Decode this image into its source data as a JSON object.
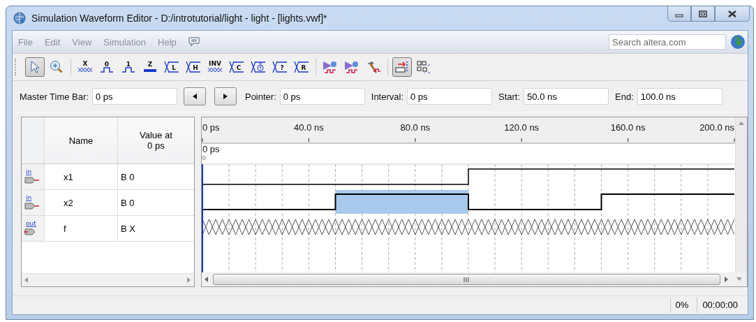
{
  "window": {
    "title": "Simulation Waveform Editor - D:/introtutorial/light - light - [lights.vwf]*"
  },
  "menu": [
    "File",
    "Edit",
    "View",
    "Simulation",
    "Help"
  ],
  "search": {
    "placeholder": "Search altera.com"
  },
  "toolbar": [
    {
      "kind": "pointer",
      "selected": true,
      "separator_before": false
    },
    {
      "kind": "zoom",
      "selected": false,
      "separator_before": false
    },
    {
      "kind": "unknown",
      "label": "X",
      "selected": false,
      "separator_before": true
    },
    {
      "kind": "level",
      "label": "0",
      "selected": false,
      "separator_before": false
    },
    {
      "kind": "level",
      "label": "1",
      "selected": false,
      "separator_before": false
    },
    {
      "kind": "bar",
      "label": "Z",
      "selected": false,
      "separator_before": false
    },
    {
      "kind": "cross",
      "label": "L",
      "selected": false,
      "separator_before": false
    },
    {
      "kind": "cross",
      "label": "H",
      "selected": false,
      "separator_before": false
    },
    {
      "kind": "unknown",
      "label": "INV",
      "selected": false,
      "separator_before": false
    },
    {
      "kind": "cross",
      "label": "C",
      "selected": false,
      "separator_before": false
    },
    {
      "kind": "clock",
      "selected": false,
      "separator_before": false
    },
    {
      "kind": "cross",
      "label": "?",
      "selected": false,
      "separator_before": false
    },
    {
      "kind": "cross",
      "label": "R",
      "selected": false,
      "separator_before": false
    },
    {
      "kind": "run",
      "selected": false,
      "separator_before": true
    },
    {
      "kind": "run",
      "selected": false,
      "separator_before": false
    },
    {
      "kind": "hammer",
      "selected": false,
      "separator_before": false
    },
    {
      "kind": "snap",
      "selected": true,
      "separator_before": true
    },
    {
      "kind": "grid",
      "selected": false,
      "separator_before": false
    }
  ],
  "time_controls": [
    {
      "kind": "field",
      "label": "Master Time Bar:",
      "value": "0 ps"
    },
    {
      "kind": "prev"
    },
    {
      "kind": "next"
    },
    {
      "kind": "field",
      "label": "Pointer:",
      "value": "0 ps"
    },
    {
      "kind": "field",
      "label": "Interval:",
      "value": "0 ps"
    },
    {
      "kind": "field",
      "label": "Start:",
      "value": "50.0 ns"
    },
    {
      "kind": "field",
      "label": "End:",
      "value": "100.0 ns"
    }
  ],
  "columns": [
    {
      "lines": [
        "Name"
      ]
    },
    {
      "lines": [
        "Value at",
        "0 ps"
      ]
    }
  ],
  "signals": [
    {
      "port": "in",
      "name": "x1",
      "value": "B 0",
      "kind": "bit",
      "segments": [
        {
          "kind": "low"
        },
        {
          "kind": "low"
        },
        {
          "kind": "high"
        },
        {
          "kind": "high"
        }
      ]
    },
    {
      "port": "in",
      "name": "x2",
      "value": "B 0",
      "kind": "bit",
      "segments": [
        {
          "kind": "low"
        },
        {
          "kind": "highlighted"
        },
        {
          "kind": "low"
        },
        {
          "kind": "high"
        }
      ]
    },
    {
      "port": "out",
      "name": "f",
      "value": "B X",
      "kind": "unknown"
    }
  ],
  "waveform": {
    "marker_label": "0 ps",
    "ruler": [
      "0 ps",
      "40.0 ns",
      "80.0 ns",
      "120.0 ns",
      "160.0 ns",
      "200.0 ns"
    ]
  },
  "status": [
    "0%",
    "00:00:00"
  ]
}
